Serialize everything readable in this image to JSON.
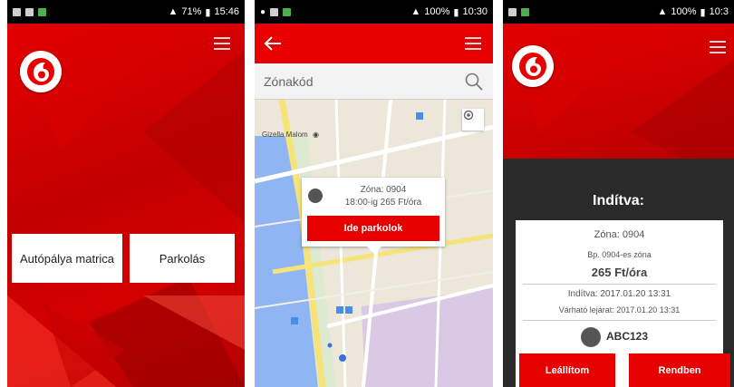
{
  "screen1": {
    "status": {
      "battery": "71%",
      "time": "15:46"
    },
    "buttons": {
      "highway_vignette": "Autópálya matrica",
      "parking": "Parkolás"
    }
  },
  "screen2": {
    "status": {
      "battery": "100%",
      "time": "10:30"
    },
    "search": {
      "placeholder": "Zónakód"
    },
    "map": {
      "poi_label": "Gizella Malom"
    },
    "popup": {
      "zone": "Zóna: 0904",
      "time_price": "18:00-ig 265 Ft/óra",
      "park_here": "Ide parkolok"
    }
  },
  "screen3": {
    "status": {
      "battery": "100%",
      "time": "10:3"
    },
    "title": "Indítva:",
    "details": {
      "zone": "Zóna: 0904",
      "zone_name": "Bp. 0904-es zóna",
      "price": "265 Ft/óra",
      "started": "Indítva: 2017.01.20 13:31",
      "expiry": "Várható lejárat: 2017.01.20 13:31",
      "plate": "ABC123"
    },
    "buttons": {
      "stop": "Leállítom",
      "ok": "Rendben"
    }
  },
  "colors": {
    "brand_red": "#e60000",
    "dark_panel": "#2a2a2a",
    "map_water": "#8fb5f2",
    "map_zone": "#d9c9e4"
  },
  "icons": [
    "vodafone-logo",
    "menu-icon",
    "back-arrow-icon",
    "search-icon",
    "locate-icon",
    "car-icon",
    "map-marker-icon"
  ]
}
